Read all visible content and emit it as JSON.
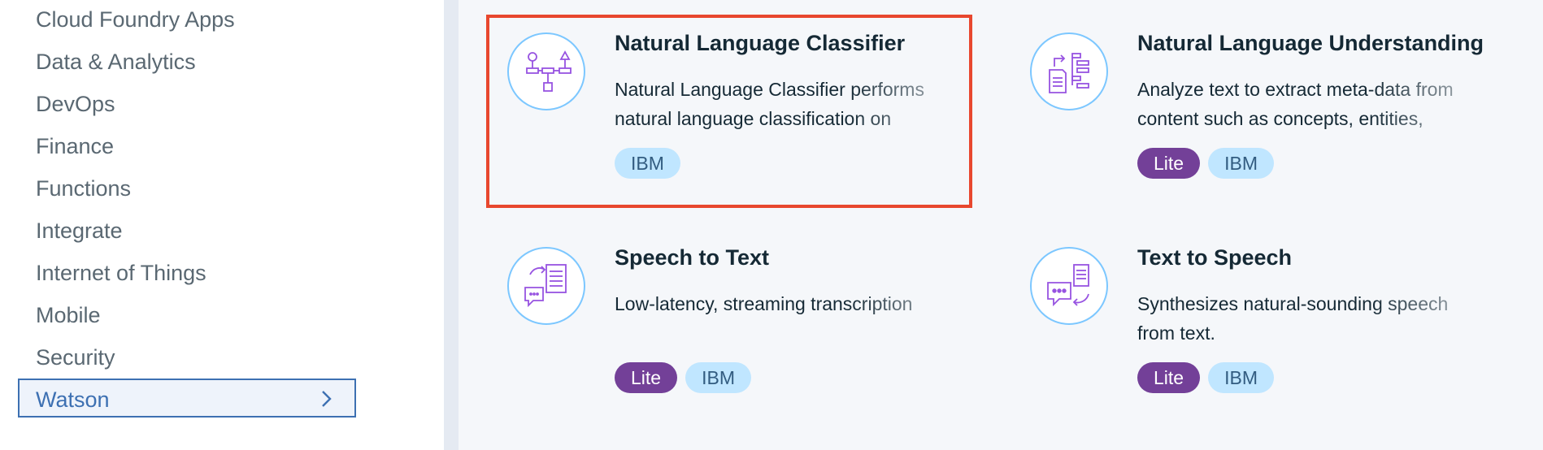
{
  "sidebar": {
    "items": [
      {
        "label": "Cloud Foundry Apps"
      },
      {
        "label": "Data & Analytics"
      },
      {
        "label": "DevOps"
      },
      {
        "label": "Finance"
      },
      {
        "label": "Functions"
      },
      {
        "label": "Integrate"
      },
      {
        "label": "Internet of Things"
      },
      {
        "label": "Mobile"
      },
      {
        "label": "Security"
      },
      {
        "label": "Watson",
        "selected": true
      }
    ]
  },
  "services": [
    {
      "title": "Natural Language Classifier",
      "description": "Natural Language Classifier performs natural language classification on",
      "tags": [
        "IBM"
      ],
      "icon": "flowchart-icon"
    },
    {
      "title": "Natural Language Understanding",
      "description": "Analyze text to extract meta-data from content such as concepts, entities,",
      "tags": [
        "Lite",
        "IBM"
      ],
      "icon": "document-extract-icon"
    },
    {
      "title": "Speech to Text",
      "description": "Low-latency, streaming transcription",
      "tags": [
        "Lite",
        "IBM"
      ],
      "icon": "speech-to-text-icon"
    },
    {
      "title": "Text to Speech",
      "description": "Synthesizes natural-sounding speech from text.",
      "tags": [
        "Lite",
        "IBM"
      ],
      "icon": "text-to-speech-icon"
    }
  ],
  "colors": {
    "highlight": "#e8472e",
    "lite_tag": "#734098",
    "ibm_tag": "#c0e6ff",
    "selected_border": "#3d70b2",
    "icon_stroke": "#9753e1"
  }
}
